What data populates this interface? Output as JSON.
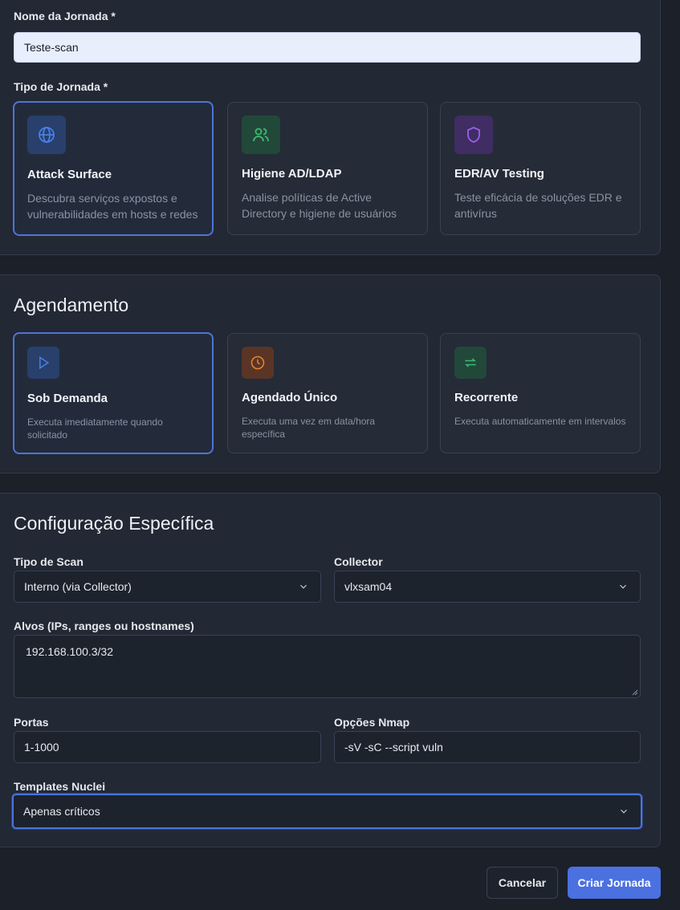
{
  "journey": {
    "name_label": "Nome da Jornada *",
    "name_value": "Teste-scan",
    "type_label": "Tipo de Jornada *",
    "types": [
      {
        "title": "Attack Surface",
        "desc": "Descubra serviços expostos e vulnerabilidades em hosts e redes",
        "icon": "globe-icon",
        "color": "#4a7fe8",
        "bg": "#28406b"
      },
      {
        "title": "Higiene AD/LDAP",
        "desc": "Analise políticas de Active Directory e higiene de usuários",
        "icon": "users-icon",
        "color": "#3dbb72",
        "bg": "#22483a"
      },
      {
        "title": "EDR/AV Testing",
        "desc": "Teste eficácia de soluções EDR e antivírus",
        "icon": "shield-icon",
        "color": "#9c5fe6",
        "bg": "#3f2d63"
      }
    ]
  },
  "schedule": {
    "heading": "Agendamento",
    "options": [
      {
        "title": "Sob Demanda",
        "desc": "Executa imediatamente quando solicitado",
        "icon": "play-icon",
        "color": "#4a7fe8",
        "bg": "#28406b"
      },
      {
        "title": "Agendado Único",
        "desc": "Executa uma vez em data/hora específica",
        "icon": "clock-icon",
        "color": "#e8852d",
        "bg": "#5a3526"
      },
      {
        "title": "Recorrente",
        "desc": "Executa automaticamente em intervalos",
        "icon": "repeat-icon",
        "color": "#3dbb72",
        "bg": "#22483a"
      }
    ]
  },
  "config": {
    "heading": "Configuração Específica",
    "scan_type_label": "Tipo de Scan",
    "scan_type_value": "Interno (via Collector)",
    "collector_label": "Collector",
    "collector_value": "vlxsam04",
    "targets_label": "Alvos (IPs, ranges ou hostnames)",
    "targets_value": "192.168.100.3/32",
    "ports_label": "Portas",
    "ports_value": "1-1000",
    "nmap_label": "Opções Nmap",
    "nmap_value": "-sV -sC --script vuln",
    "nuclei_label": "Templates Nuclei",
    "nuclei_value": "Apenas críticos"
  },
  "actions": {
    "cancel": "Cancelar",
    "create": "Criar Jornada"
  }
}
